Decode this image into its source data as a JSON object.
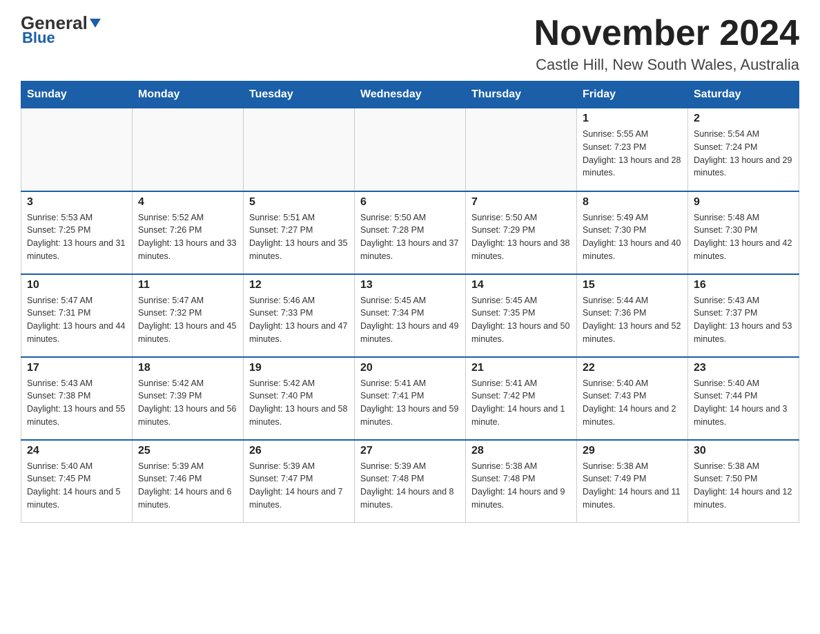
{
  "header": {
    "logo_general": "General",
    "logo_blue": "Blue",
    "main_title": "November 2024",
    "subtitle": "Castle Hill, New South Wales, Australia"
  },
  "calendar": {
    "days_of_week": [
      "Sunday",
      "Monday",
      "Tuesday",
      "Wednesday",
      "Thursday",
      "Friday",
      "Saturday"
    ],
    "weeks": [
      [
        {
          "day": "",
          "info": ""
        },
        {
          "day": "",
          "info": ""
        },
        {
          "day": "",
          "info": ""
        },
        {
          "day": "",
          "info": ""
        },
        {
          "day": "",
          "info": ""
        },
        {
          "day": "1",
          "info": "Sunrise: 5:55 AM\nSunset: 7:23 PM\nDaylight: 13 hours and 28 minutes."
        },
        {
          "day": "2",
          "info": "Sunrise: 5:54 AM\nSunset: 7:24 PM\nDaylight: 13 hours and 29 minutes."
        }
      ],
      [
        {
          "day": "3",
          "info": "Sunrise: 5:53 AM\nSunset: 7:25 PM\nDaylight: 13 hours and 31 minutes."
        },
        {
          "day": "4",
          "info": "Sunrise: 5:52 AM\nSunset: 7:26 PM\nDaylight: 13 hours and 33 minutes."
        },
        {
          "day": "5",
          "info": "Sunrise: 5:51 AM\nSunset: 7:27 PM\nDaylight: 13 hours and 35 minutes."
        },
        {
          "day": "6",
          "info": "Sunrise: 5:50 AM\nSunset: 7:28 PM\nDaylight: 13 hours and 37 minutes."
        },
        {
          "day": "7",
          "info": "Sunrise: 5:50 AM\nSunset: 7:29 PM\nDaylight: 13 hours and 38 minutes."
        },
        {
          "day": "8",
          "info": "Sunrise: 5:49 AM\nSunset: 7:30 PM\nDaylight: 13 hours and 40 minutes."
        },
        {
          "day": "9",
          "info": "Sunrise: 5:48 AM\nSunset: 7:30 PM\nDaylight: 13 hours and 42 minutes."
        }
      ],
      [
        {
          "day": "10",
          "info": "Sunrise: 5:47 AM\nSunset: 7:31 PM\nDaylight: 13 hours and 44 minutes."
        },
        {
          "day": "11",
          "info": "Sunrise: 5:47 AM\nSunset: 7:32 PM\nDaylight: 13 hours and 45 minutes."
        },
        {
          "day": "12",
          "info": "Sunrise: 5:46 AM\nSunset: 7:33 PM\nDaylight: 13 hours and 47 minutes."
        },
        {
          "day": "13",
          "info": "Sunrise: 5:45 AM\nSunset: 7:34 PM\nDaylight: 13 hours and 49 minutes."
        },
        {
          "day": "14",
          "info": "Sunrise: 5:45 AM\nSunset: 7:35 PM\nDaylight: 13 hours and 50 minutes."
        },
        {
          "day": "15",
          "info": "Sunrise: 5:44 AM\nSunset: 7:36 PM\nDaylight: 13 hours and 52 minutes."
        },
        {
          "day": "16",
          "info": "Sunrise: 5:43 AM\nSunset: 7:37 PM\nDaylight: 13 hours and 53 minutes."
        }
      ],
      [
        {
          "day": "17",
          "info": "Sunrise: 5:43 AM\nSunset: 7:38 PM\nDaylight: 13 hours and 55 minutes."
        },
        {
          "day": "18",
          "info": "Sunrise: 5:42 AM\nSunset: 7:39 PM\nDaylight: 13 hours and 56 minutes."
        },
        {
          "day": "19",
          "info": "Sunrise: 5:42 AM\nSunset: 7:40 PM\nDaylight: 13 hours and 58 minutes."
        },
        {
          "day": "20",
          "info": "Sunrise: 5:41 AM\nSunset: 7:41 PM\nDaylight: 13 hours and 59 minutes."
        },
        {
          "day": "21",
          "info": "Sunrise: 5:41 AM\nSunset: 7:42 PM\nDaylight: 14 hours and 1 minute."
        },
        {
          "day": "22",
          "info": "Sunrise: 5:40 AM\nSunset: 7:43 PM\nDaylight: 14 hours and 2 minutes."
        },
        {
          "day": "23",
          "info": "Sunrise: 5:40 AM\nSunset: 7:44 PM\nDaylight: 14 hours and 3 minutes."
        }
      ],
      [
        {
          "day": "24",
          "info": "Sunrise: 5:40 AM\nSunset: 7:45 PM\nDaylight: 14 hours and 5 minutes."
        },
        {
          "day": "25",
          "info": "Sunrise: 5:39 AM\nSunset: 7:46 PM\nDaylight: 14 hours and 6 minutes."
        },
        {
          "day": "26",
          "info": "Sunrise: 5:39 AM\nSunset: 7:47 PM\nDaylight: 14 hours and 7 minutes."
        },
        {
          "day": "27",
          "info": "Sunrise: 5:39 AM\nSunset: 7:48 PM\nDaylight: 14 hours and 8 minutes."
        },
        {
          "day": "28",
          "info": "Sunrise: 5:38 AM\nSunset: 7:48 PM\nDaylight: 14 hours and 9 minutes."
        },
        {
          "day": "29",
          "info": "Sunrise: 5:38 AM\nSunset: 7:49 PM\nDaylight: 14 hours and 11 minutes."
        },
        {
          "day": "30",
          "info": "Sunrise: 5:38 AM\nSunset: 7:50 PM\nDaylight: 14 hours and 12 minutes."
        }
      ]
    ]
  }
}
